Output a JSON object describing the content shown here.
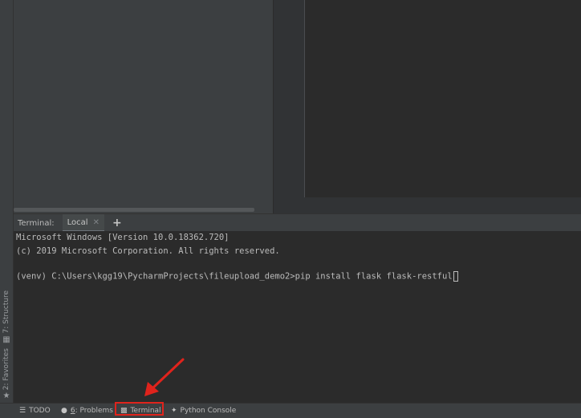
{
  "left_toolbar": {
    "structure": {
      "label": "7: Structure",
      "icon": "structure-icon"
    },
    "favorites": {
      "label": "2: Favorites",
      "icon": "star-icon"
    }
  },
  "terminal": {
    "title": "Terminal:",
    "tabs": [
      {
        "label": "Local"
      }
    ],
    "new_tab": "+",
    "lines": [
      "Microsoft Windows [Version 10.0.18362.720]",
      "(c) 2019 Microsoft Corporation. All rights reserved.",
      "",
      "(venv) C:\\Users\\kgg19\\PycharmProjects\\fileupload_demo2>pip install flask flask-restful"
    ]
  },
  "status_bar": {
    "todo": {
      "label": "TODO",
      "icon": "list-icon"
    },
    "problems": {
      "hotkey": "6",
      "label": ": Problems",
      "icon": "problems-icon"
    },
    "terminal": {
      "label": "Terminal",
      "icon": "terminal-icon"
    },
    "python_console": {
      "label": "Python Console",
      "icon": "python-icon"
    }
  },
  "annotation": {
    "color": "#e0231c"
  }
}
